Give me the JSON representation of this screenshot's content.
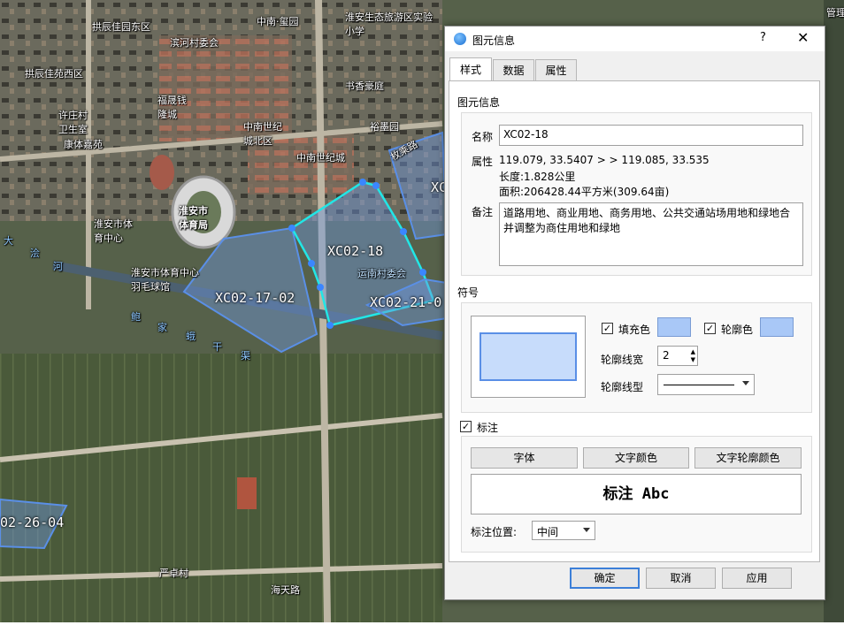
{
  "map": {
    "labels": [
      "拱辰佳园东区",
      "滨河村委会",
      "中南·玺园",
      "淮安生态旅游区实验小学",
      "拱辰佳苑西区",
      "福晟钱隆城",
      "书香豪庭",
      "许庄村卫生室",
      "中南世纪城北区",
      "裕墨园",
      "康体嘉苑",
      "中南世纪城",
      "枚乘路",
      "淮安市体育局",
      "淮安市体育中心",
      "淮安市体育中心羽毛球馆",
      "运南村委会",
      "大",
      "浍",
      "河",
      "鲍",
      "家",
      "蛾",
      "干",
      "渠",
      "严卓村",
      "海天路",
      "管理"
    ],
    "parcels": [
      "XC02-18",
      "XC02-17-02",
      "XC02-21-0",
      "XC",
      "02-26-04"
    ]
  },
  "dialog": {
    "title": "图元信息",
    "help": "?",
    "close": "✕",
    "tabs": [
      "样式",
      "数据",
      "属性"
    ],
    "info_section": "图元信息",
    "name_label": "名称",
    "name_value": "XC02-18",
    "attr_label": "属性",
    "attr_line1": "119.079, 33.5407 > > 119.085, 33.535",
    "attr_line2": "长度:1.828公里",
    "attr_line3": "面积:206428.44平方米(309.64亩)",
    "note_label": "备注",
    "note_value": "道路用地、商业用地、商务用地、公共交通站场用地和绿地合并调整为商住用地和绿地",
    "symbol_section": "符号",
    "fill_checked": "✓",
    "fill_label": "填充色",
    "outline_checked": "✓",
    "outline_label": "轮廓色",
    "fill_color": "#a9c8f7",
    "outline_color": "#a9c8f7",
    "line_width_label": "轮廓线宽",
    "line_width_value": "2",
    "line_type_label": "轮廓线型",
    "annot_checked": "✓",
    "annot_section": "标注",
    "font_button": "字体",
    "text_color_button": "文字颜色",
    "text_outline_button": "文字轮廓颜色",
    "annot_preview": "标注 Abc",
    "annot_pos_label": "标注位置:",
    "annot_pos_value": "中间",
    "ok_button": "确定",
    "cancel_button": "取消",
    "apply_button": "应用"
  }
}
